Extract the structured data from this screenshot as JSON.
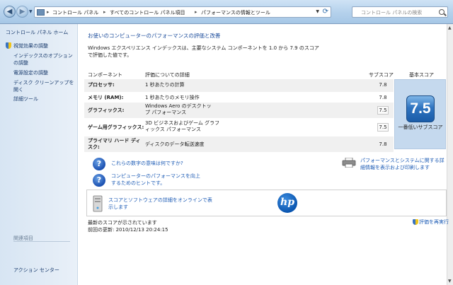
{
  "address_bar": {
    "breadcrumbs": [
      "コントロール パネル",
      "すべてのコントロール パネル項目",
      "パフォーマンスの情報とツール"
    ]
  },
  "search": {
    "placeholder": "コントロール パネルの検索"
  },
  "sidebar": {
    "home": "コントロール パネル ホーム",
    "items": [
      "視覚効果の調整",
      "インデックスのオプションの調整",
      "電源設定の調整",
      "ディスク クリーンアップを開く",
      "詳細ツール"
    ],
    "related_heading": "関連項目",
    "related_items": [
      "アクション センター"
    ]
  },
  "main": {
    "title": "お使いのコンピューターのパフォーマンスの評価と改善",
    "description": "Windows エクスペリエンス インデックスは、主要なシステム コンポーネントを 1.0 から 7.9 のスコアで評価した値です。",
    "table": {
      "headers": {
        "component": "コンポーネント",
        "detail": "評価についての詳細",
        "subscore": "サブスコア",
        "basescore": "基本スコア"
      },
      "rows": [
        {
          "component": "プロセッサ:",
          "detail": "1 秒あたりの計算",
          "subscore": "7.8"
        },
        {
          "component": "メモリ (RAM):",
          "detail": "1 秒あたりのメモリ操作",
          "subscore": "7.8"
        },
        {
          "component": "グラフィックス:",
          "detail": "Windows Aero のデスクトップ パフォーマンス",
          "subscore": "7.5"
        },
        {
          "component": "ゲーム用グラフィックス:",
          "detail": "3D ビジネスおよびゲーム グラフィックス パフォーマンス",
          "subscore": "7.5"
        },
        {
          "component": "プライマリ ハード ディスク:",
          "detail": "ディスクのデータ転送速度",
          "subscore": "7.8"
        }
      ],
      "base_score": "7.5",
      "base_caption": "一番低いサブスコア"
    },
    "links": {
      "meaning": "これらの数字の意味は何ですか?",
      "tips": "コンピューターのパフォーマンスを向上するためのヒントです。",
      "print": "パフォーマンスとシステムに関する詳細情報を表示および印刷します",
      "online": "スコアとソフトウェアの詳細をオンラインで表示します"
    },
    "oem_logo_text": "hp",
    "footer": {
      "status": "最新のスコアが示されています",
      "last_update": "前回の更新: 2010/12/13 20:24:15",
      "rerun": "評価を再実行"
    }
  }
}
